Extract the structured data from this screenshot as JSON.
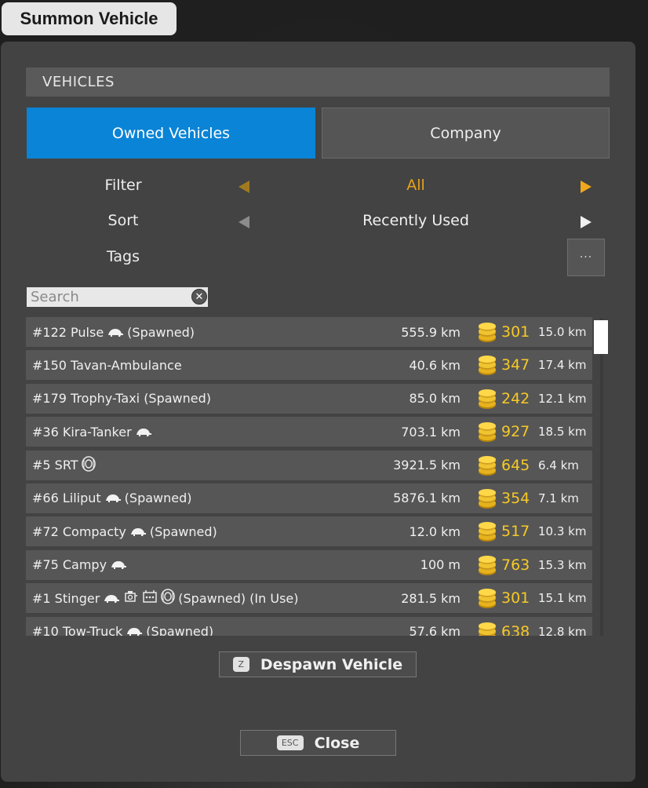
{
  "window_title": "Summon Vehicle",
  "section_title": "VEHICLES",
  "tabs": [
    {
      "label": "Owned Vehicles",
      "active": true
    },
    {
      "label": "Company",
      "active": false
    }
  ],
  "options": {
    "filter": {
      "label": "Filter",
      "value": "All"
    },
    "sort": {
      "label": "Sort",
      "value": "Recently Used"
    },
    "tags": {
      "label": "Tags",
      "button": "···"
    }
  },
  "search": {
    "placeholder": "Search",
    "value": ""
  },
  "vehicles": [
    {
      "name": "#122 Pulse",
      "icons": [
        "turtle-icon"
      ],
      "suffix": "(Spawned)",
      "distance": "555.9 km",
      "price": "301",
      "range": "15.0 km"
    },
    {
      "name": "#150 Tavan-Ambulance",
      "icons": [],
      "suffix": "",
      "distance": "40.6 km",
      "price": "347",
      "range": "17.4 km"
    },
    {
      "name": "#179 Trophy-Taxi (Spawned)",
      "icons": [],
      "suffix": "",
      "distance": "85.0 km",
      "price": "242",
      "range": "12.1 km"
    },
    {
      "name": "#36 Kira-Tanker",
      "icons": [
        "turtle-icon"
      ],
      "suffix": "",
      "distance": "703.1 km",
      "price": "927",
      "range": "18.5 km"
    },
    {
      "name": "#5 SRT",
      "icons": [
        "tire-icon"
      ],
      "suffix": "",
      "distance": "3921.5 km",
      "price": "645",
      "range": "6.4 km"
    },
    {
      "name": "#66 Liliput",
      "icons": [
        "turtle-icon"
      ],
      "suffix": "(Spawned)",
      "distance": "5876.1 km",
      "price": "354",
      "range": "7.1 km"
    },
    {
      "name": "#72 Compacty",
      "icons": [
        "turtle-icon"
      ],
      "suffix": "(Spawned)",
      "distance": "12.0 km",
      "price": "517",
      "range": "10.3 km"
    },
    {
      "name": "#75 Campy",
      "icons": [
        "turtle-icon"
      ],
      "suffix": "",
      "distance": "100 m",
      "price": "763",
      "range": "15.3 km"
    },
    {
      "name": "#1 Stinger",
      "icons": [
        "turtle-icon",
        "engine-icon",
        "transmission-icon",
        "tire-icon"
      ],
      "suffix": "(Spawned) (In Use)",
      "distance": "281.5 km",
      "price": "301",
      "range": "15.1 km"
    },
    {
      "name": "#10 Tow-Truck",
      "icons": [
        "turtle-icon"
      ],
      "suffix": "(Spawned)",
      "distance": "57.6 km",
      "price": "638",
      "range": "12.8 km"
    }
  ],
  "actions": {
    "despawn": {
      "key": "Z",
      "label": "Despawn Vehicle"
    },
    "close": {
      "key": "ESC",
      "label": "Close"
    }
  },
  "colors": {
    "accent": "#0a84d6",
    "gold": "#f6c928",
    "filter_active": "#e8a21a",
    "panel": "#434343"
  }
}
